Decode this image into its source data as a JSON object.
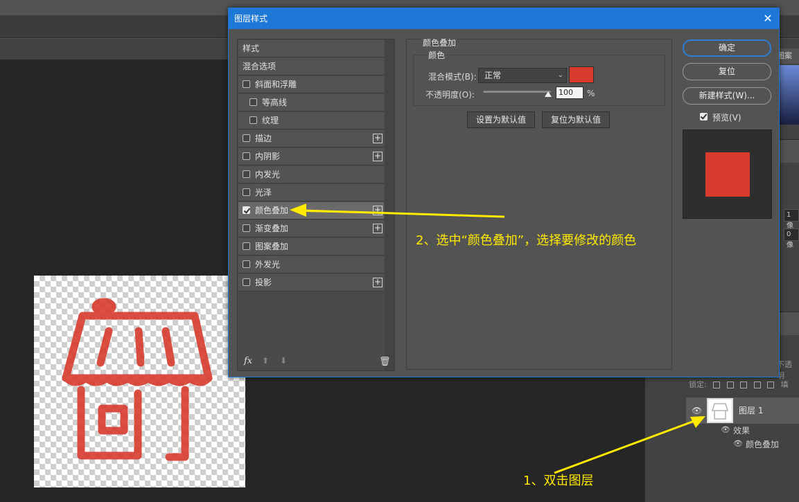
{
  "dialog": {
    "title": "图层样式",
    "close_glyph": "✕"
  },
  "style_list": {
    "header_styles": "样式",
    "header_blend": "混合选项",
    "items": [
      {
        "label": "斜面和浮雕",
        "checked": false,
        "plus": false,
        "indent": false
      },
      {
        "label": "等高线",
        "checked": false,
        "plus": false,
        "indent": true
      },
      {
        "label": "纹理",
        "checked": false,
        "plus": false,
        "indent": true
      },
      {
        "label": "描边",
        "checked": false,
        "plus": true,
        "indent": false
      },
      {
        "label": "内阴影",
        "checked": false,
        "plus": true,
        "indent": false
      },
      {
        "label": "内发光",
        "checked": false,
        "plus": false,
        "indent": false
      },
      {
        "label": "光泽",
        "checked": false,
        "plus": false,
        "indent": false
      },
      {
        "label": "颜色叠加",
        "checked": true,
        "plus": true,
        "indent": false
      },
      {
        "label": "渐变叠加",
        "checked": false,
        "plus": true,
        "indent": false
      },
      {
        "label": "图案叠加",
        "checked": false,
        "plus": false,
        "indent": false
      },
      {
        "label": "外发光",
        "checked": false,
        "plus": false,
        "indent": false
      },
      {
        "label": "投影",
        "checked": false,
        "plus": true,
        "indent": false
      }
    ],
    "plus_glyph": "+",
    "fx_label": "fx",
    "up_glyph": "⬆",
    "down_glyph": "⬇",
    "trash_glyph": "🗑"
  },
  "settings": {
    "title": "颜色叠加",
    "group_title": "颜色",
    "blend_mode_label": "混合模式(B):",
    "blend_mode_value": "正常",
    "blend_chevron": "⌄",
    "overlay_color": "#d83b2e",
    "opacity_label": "不透明度(O):",
    "opacity_value": "100",
    "opacity_fraction": 1.0,
    "opacity_unit": "%",
    "set_default_label": "设置为默认值",
    "reset_default_label": "复位为默认值"
  },
  "buttons": {
    "ok": "确定",
    "reset": "复位",
    "new_style": "新建样式(W)...",
    "preview_label": "预览(V)",
    "preview_checked": true
  },
  "layers_panel": {
    "tab_fragment": "图案",
    "field1": "1 像",
    "field2": "0 像",
    "lock_label": "锁定:",
    "lock_fragment": "填",
    "opacity_fragment": "不透明",
    "layer_name": "图层 1",
    "effects_label": "效果",
    "effect_item": "颜色叠加",
    "eye_glyph": "👁"
  },
  "annotations": {
    "step1": "1、双击图层",
    "step2": "2、选中“颜色叠加”，选择要修改的颜色",
    "color": "#ffea00"
  },
  "canvas_icon_color": "#d83b2e"
}
